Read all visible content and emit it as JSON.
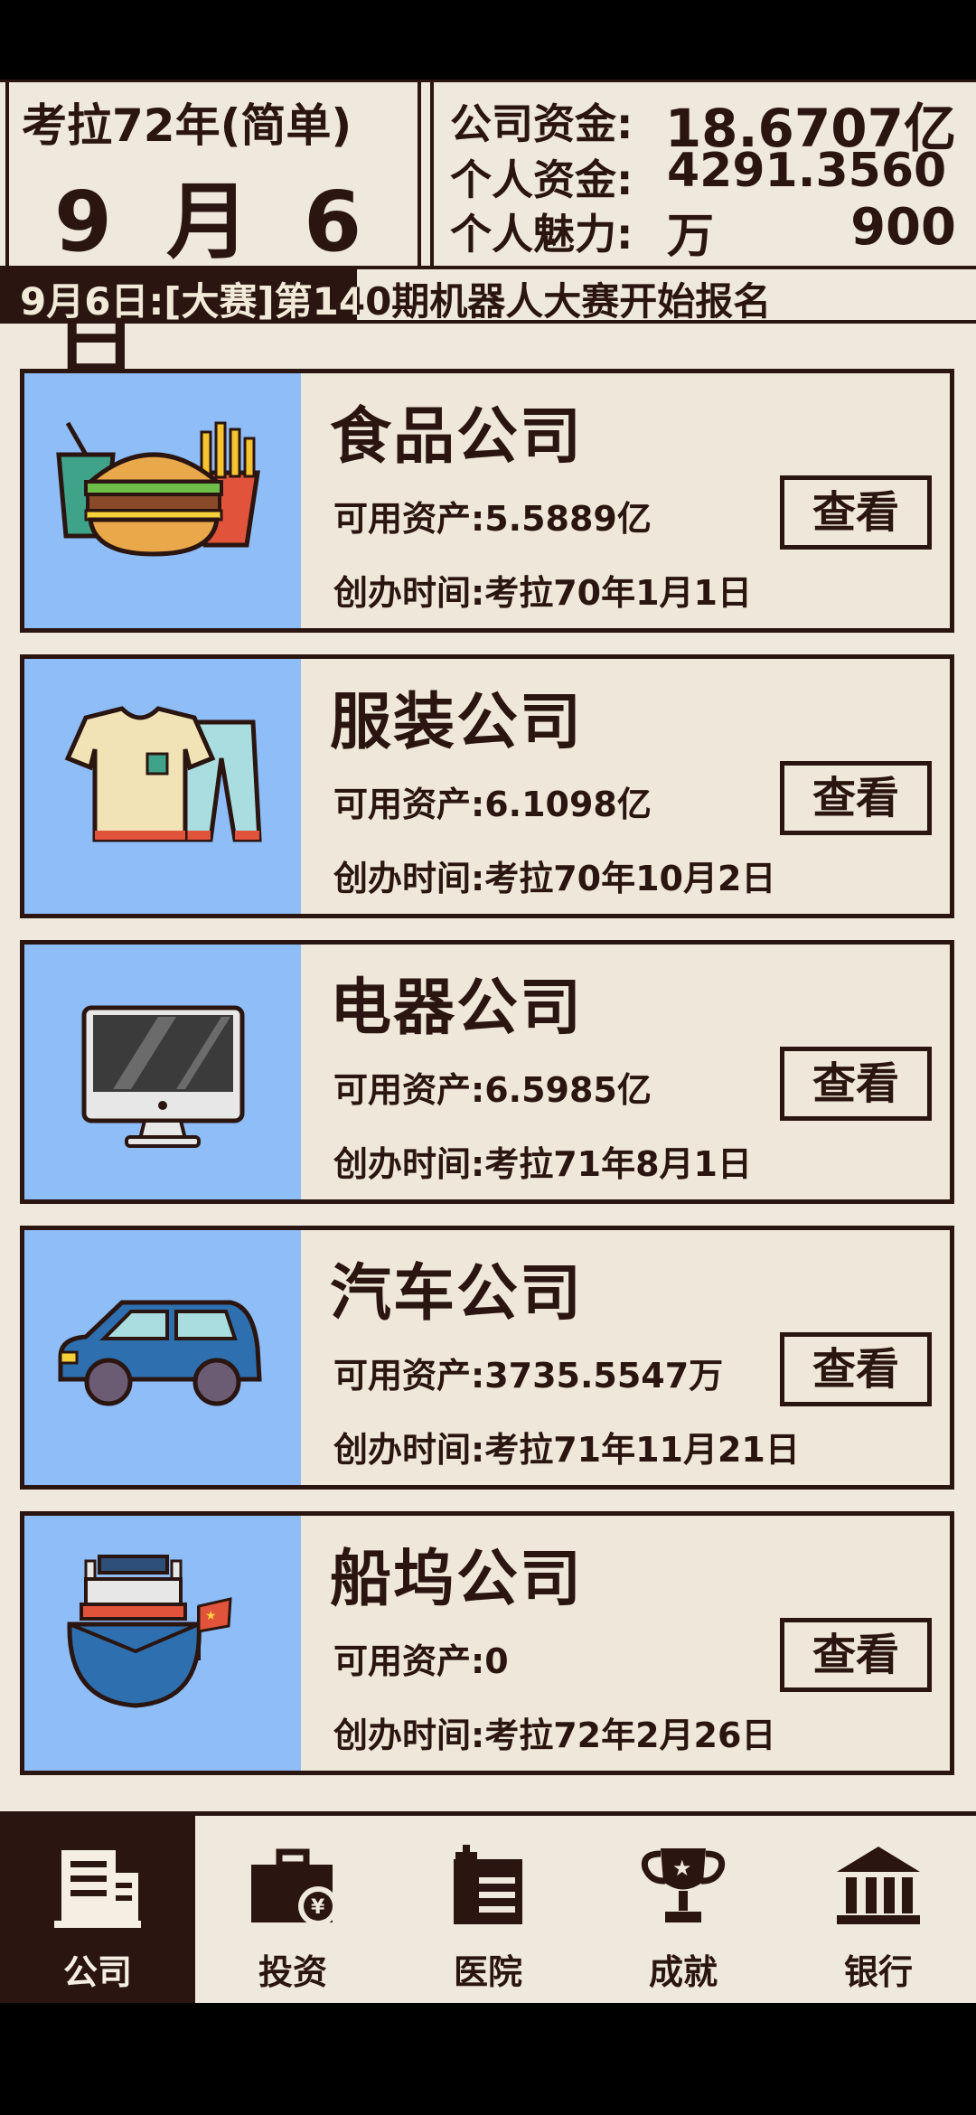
{
  "header": {
    "era": "考拉72年(简单)",
    "date": "9 月 6 日",
    "company_funds_label": "公司资金:",
    "company_funds": "18.6707亿",
    "personal_funds_label": "个人资金:",
    "personal_funds": "4291.3560万",
    "charm_label": "个人魅力:",
    "charm": "900"
  },
  "ticker": {
    "text": "9月6日:[大赛]第140期机器人大赛开始报名"
  },
  "companies": [
    {
      "name": "食品公司",
      "assets": "可用资产:5.5889亿",
      "founded": "创办时间:考拉70年1月1日",
      "button": "查看",
      "icon": "burger-fries-icon"
    },
    {
      "name": "服装公司",
      "assets": "可用资产:6.1098亿",
      "founded": "创办时间:考拉70年10月2日",
      "button": "查看",
      "icon": "shirt-pants-icon"
    },
    {
      "name": "电器公司",
      "assets": "可用资产:6.5985亿",
      "founded": "创办时间:考拉71年8月1日",
      "button": "查看",
      "icon": "monitor-icon"
    },
    {
      "name": "汽车公司",
      "assets": "可用资产:3735.5547万",
      "founded": "创办时间:考拉71年11月21日",
      "button": "查看",
      "icon": "car-icon"
    },
    {
      "name": "船坞公司",
      "assets": "可用资产:0",
      "founded": "创办时间:考拉72年2月26日",
      "button": "查看",
      "icon": "ship-icon"
    }
  ],
  "nav": [
    {
      "label": "公司",
      "icon": "building-icon",
      "active": true
    },
    {
      "label": "投资",
      "icon": "briefcase-yen-icon",
      "active": false
    },
    {
      "label": "医院",
      "icon": "hospital-icon",
      "active": false
    },
    {
      "label": "成就",
      "icon": "trophy-icon",
      "active": false
    },
    {
      "label": "银行",
      "icon": "bank-icon",
      "active": false
    }
  ],
  "colors": {
    "dark": "#2a1510",
    "paper": "#efe8dc",
    "art_bg": "#8fbdf7"
  }
}
